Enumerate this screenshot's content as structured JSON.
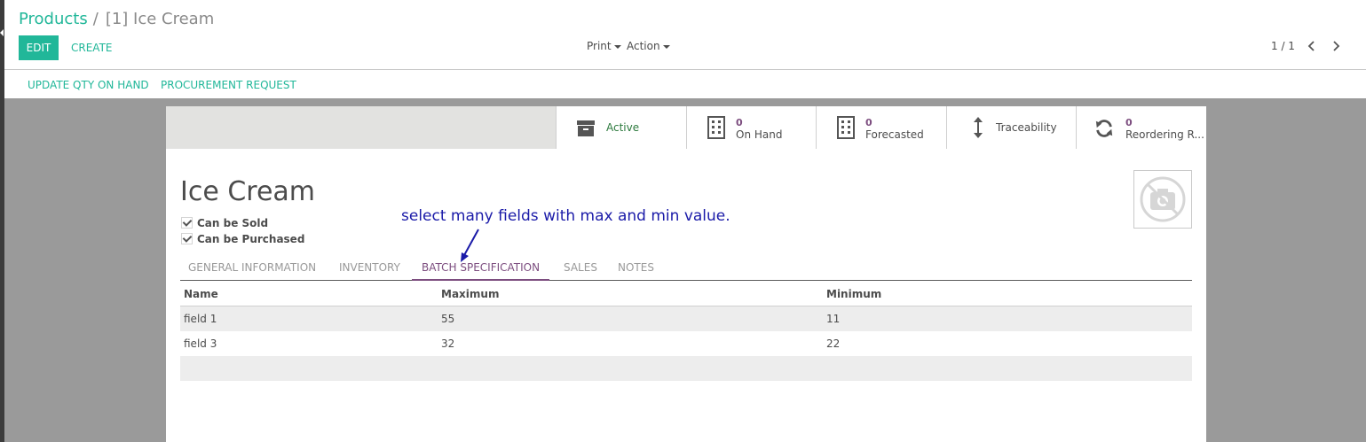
{
  "breadcrumb": {
    "parent": "Products",
    "separator": "/",
    "current": "[1] Ice Cream"
  },
  "toolbar": {
    "edit_label": "EDIT",
    "create_label": "CREATE",
    "print_label": "Print",
    "action_label": "Action"
  },
  "pager": {
    "value": "1 / 1",
    "prev_icon": "chevron-left-icon",
    "next_icon": "chevron-right-icon"
  },
  "header_buttons": {
    "update_qty": "UPDATE QTY ON HAND",
    "procurement": "PROCUREMENT REQUEST"
  },
  "stat_buttons": {
    "active": {
      "label": "Active",
      "icon": "archive-icon"
    },
    "on_hand": {
      "value": "0",
      "label": "On Hand",
      "icon": "building-icon"
    },
    "forecasted": {
      "value": "0",
      "label": "Forecasted",
      "icon": "building-icon"
    },
    "traceability": {
      "label": "Traceability",
      "icon": "arrows-vertical-icon"
    },
    "reordering": {
      "value": "0",
      "label": "Reordering R...",
      "icon": "refresh-icon"
    }
  },
  "product": {
    "name": "Ice Cream",
    "can_be_sold": "Can be Sold",
    "can_be_purchased": "Can be Purchased",
    "image_icon": "no-camera-icon"
  },
  "annotation": "select many fields with max and min value.",
  "tabs": [
    {
      "label": "GENERAL INFORMATION",
      "active": false
    },
    {
      "label": "INVENTORY",
      "active": false
    },
    {
      "label": "BATCH SPECIFICATION",
      "active": true
    },
    {
      "label": "SALES",
      "active": false
    },
    {
      "label": "NOTES",
      "active": false
    }
  ],
  "batch_table": {
    "columns": [
      "Name",
      "Maximum",
      "Minimum"
    ],
    "rows": [
      [
        "field 1",
        "55",
        "11"
      ],
      [
        "field 3",
        "32",
        "22"
      ]
    ]
  },
  "colors": {
    "accent": "#21b799",
    "active_tab": "#7c4d7f",
    "annotation": "#1a1aa8"
  }
}
